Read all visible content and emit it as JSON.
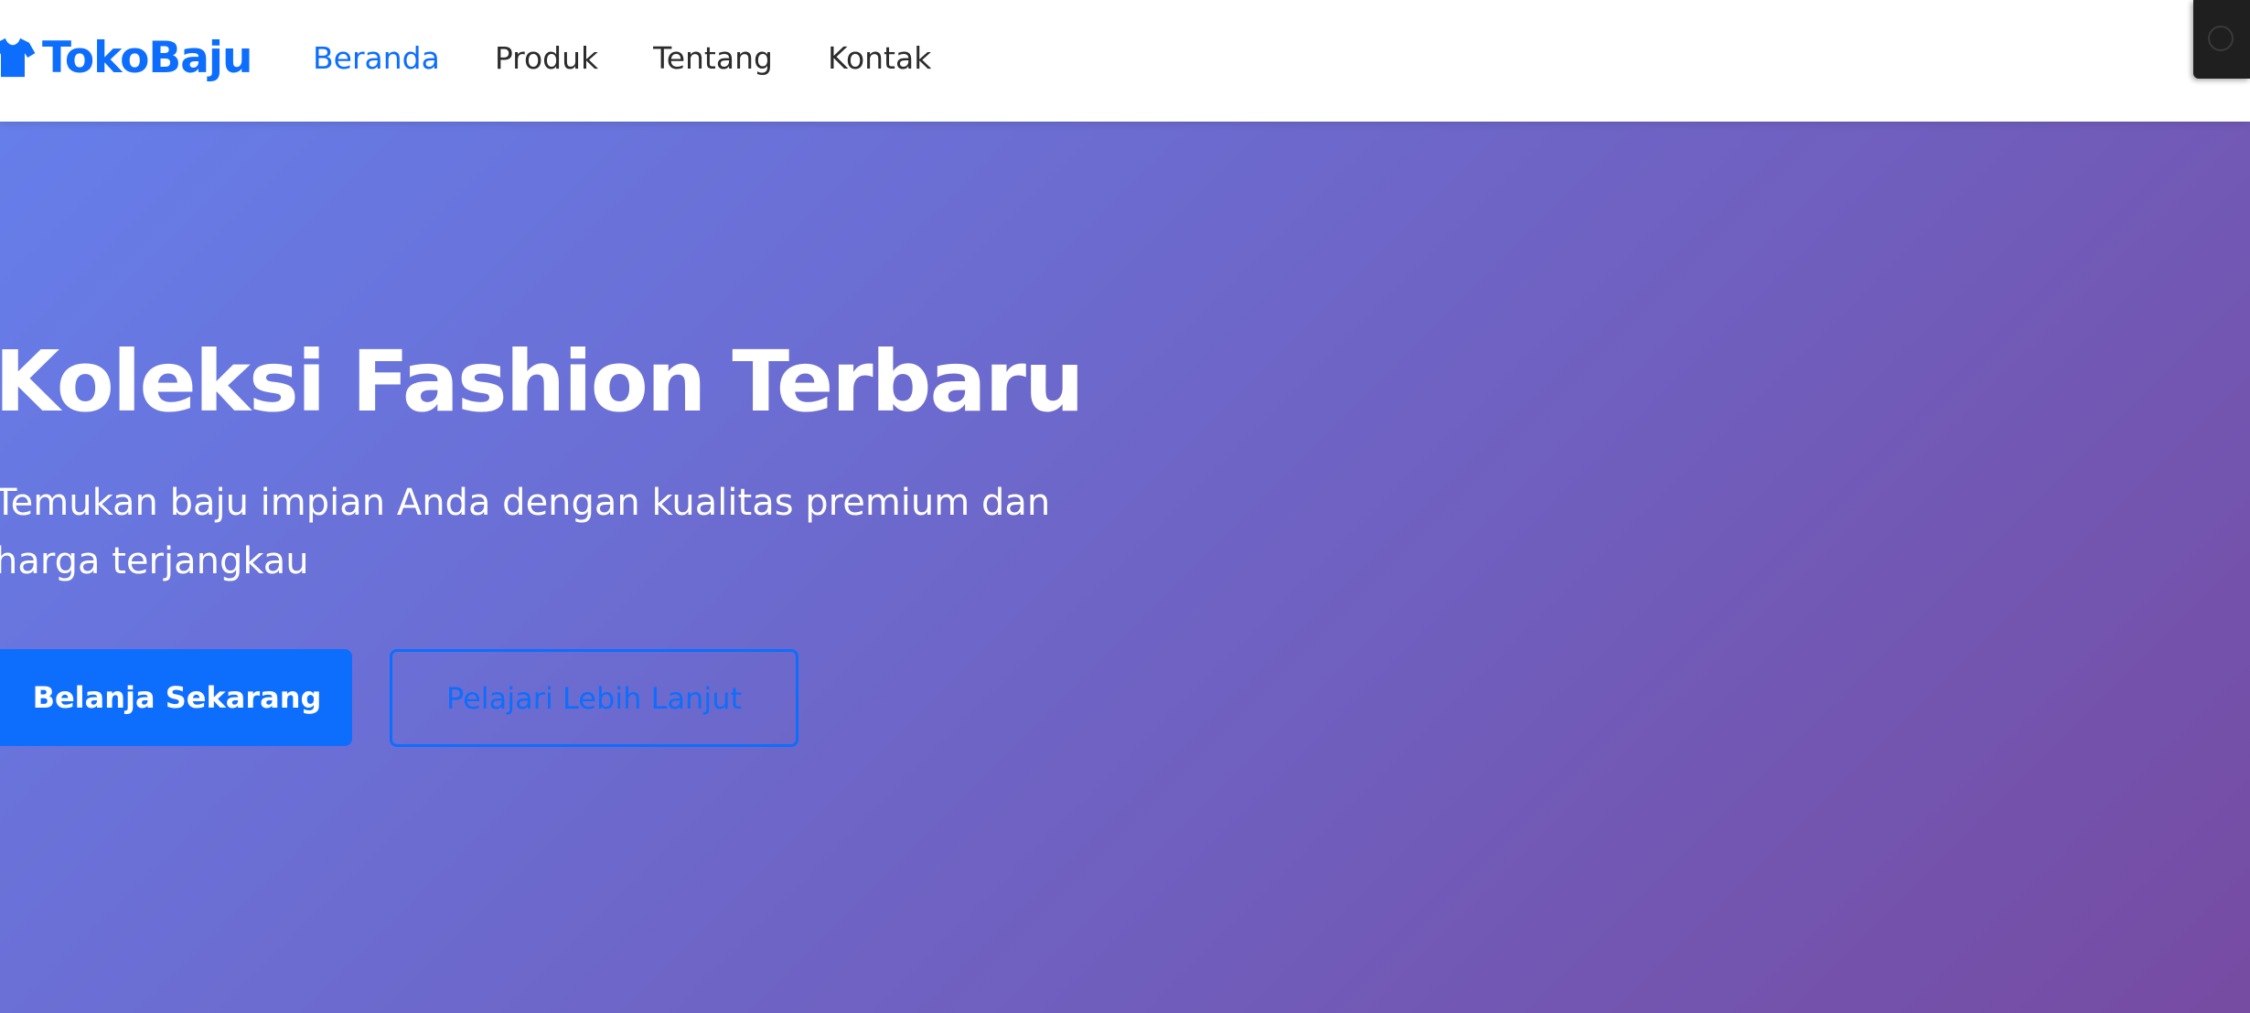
{
  "navbar": {
    "brand_name": "TokoBaju",
    "brand_icon": "tshirt-icon",
    "links": [
      {
        "label": "Beranda",
        "active": true
      },
      {
        "label": "Produk",
        "active": false
      },
      {
        "label": "Tentang",
        "active": false
      },
      {
        "label": "Kontak",
        "active": false
      }
    ]
  },
  "hero": {
    "title": "Koleksi Fashion Terbaru",
    "subtitle": "Temukan baju impian Anda dengan kualitas premium dan harga terjangkau",
    "primary_button": "Belanja Sekarang",
    "secondary_button": "Pelajari Lebih Lanjut"
  },
  "colors": {
    "accent": "#0d6efd",
    "hero_gradient_start": "#667eea",
    "hero_gradient_end": "#764ba2",
    "nav_text": "#2b2b2b"
  }
}
